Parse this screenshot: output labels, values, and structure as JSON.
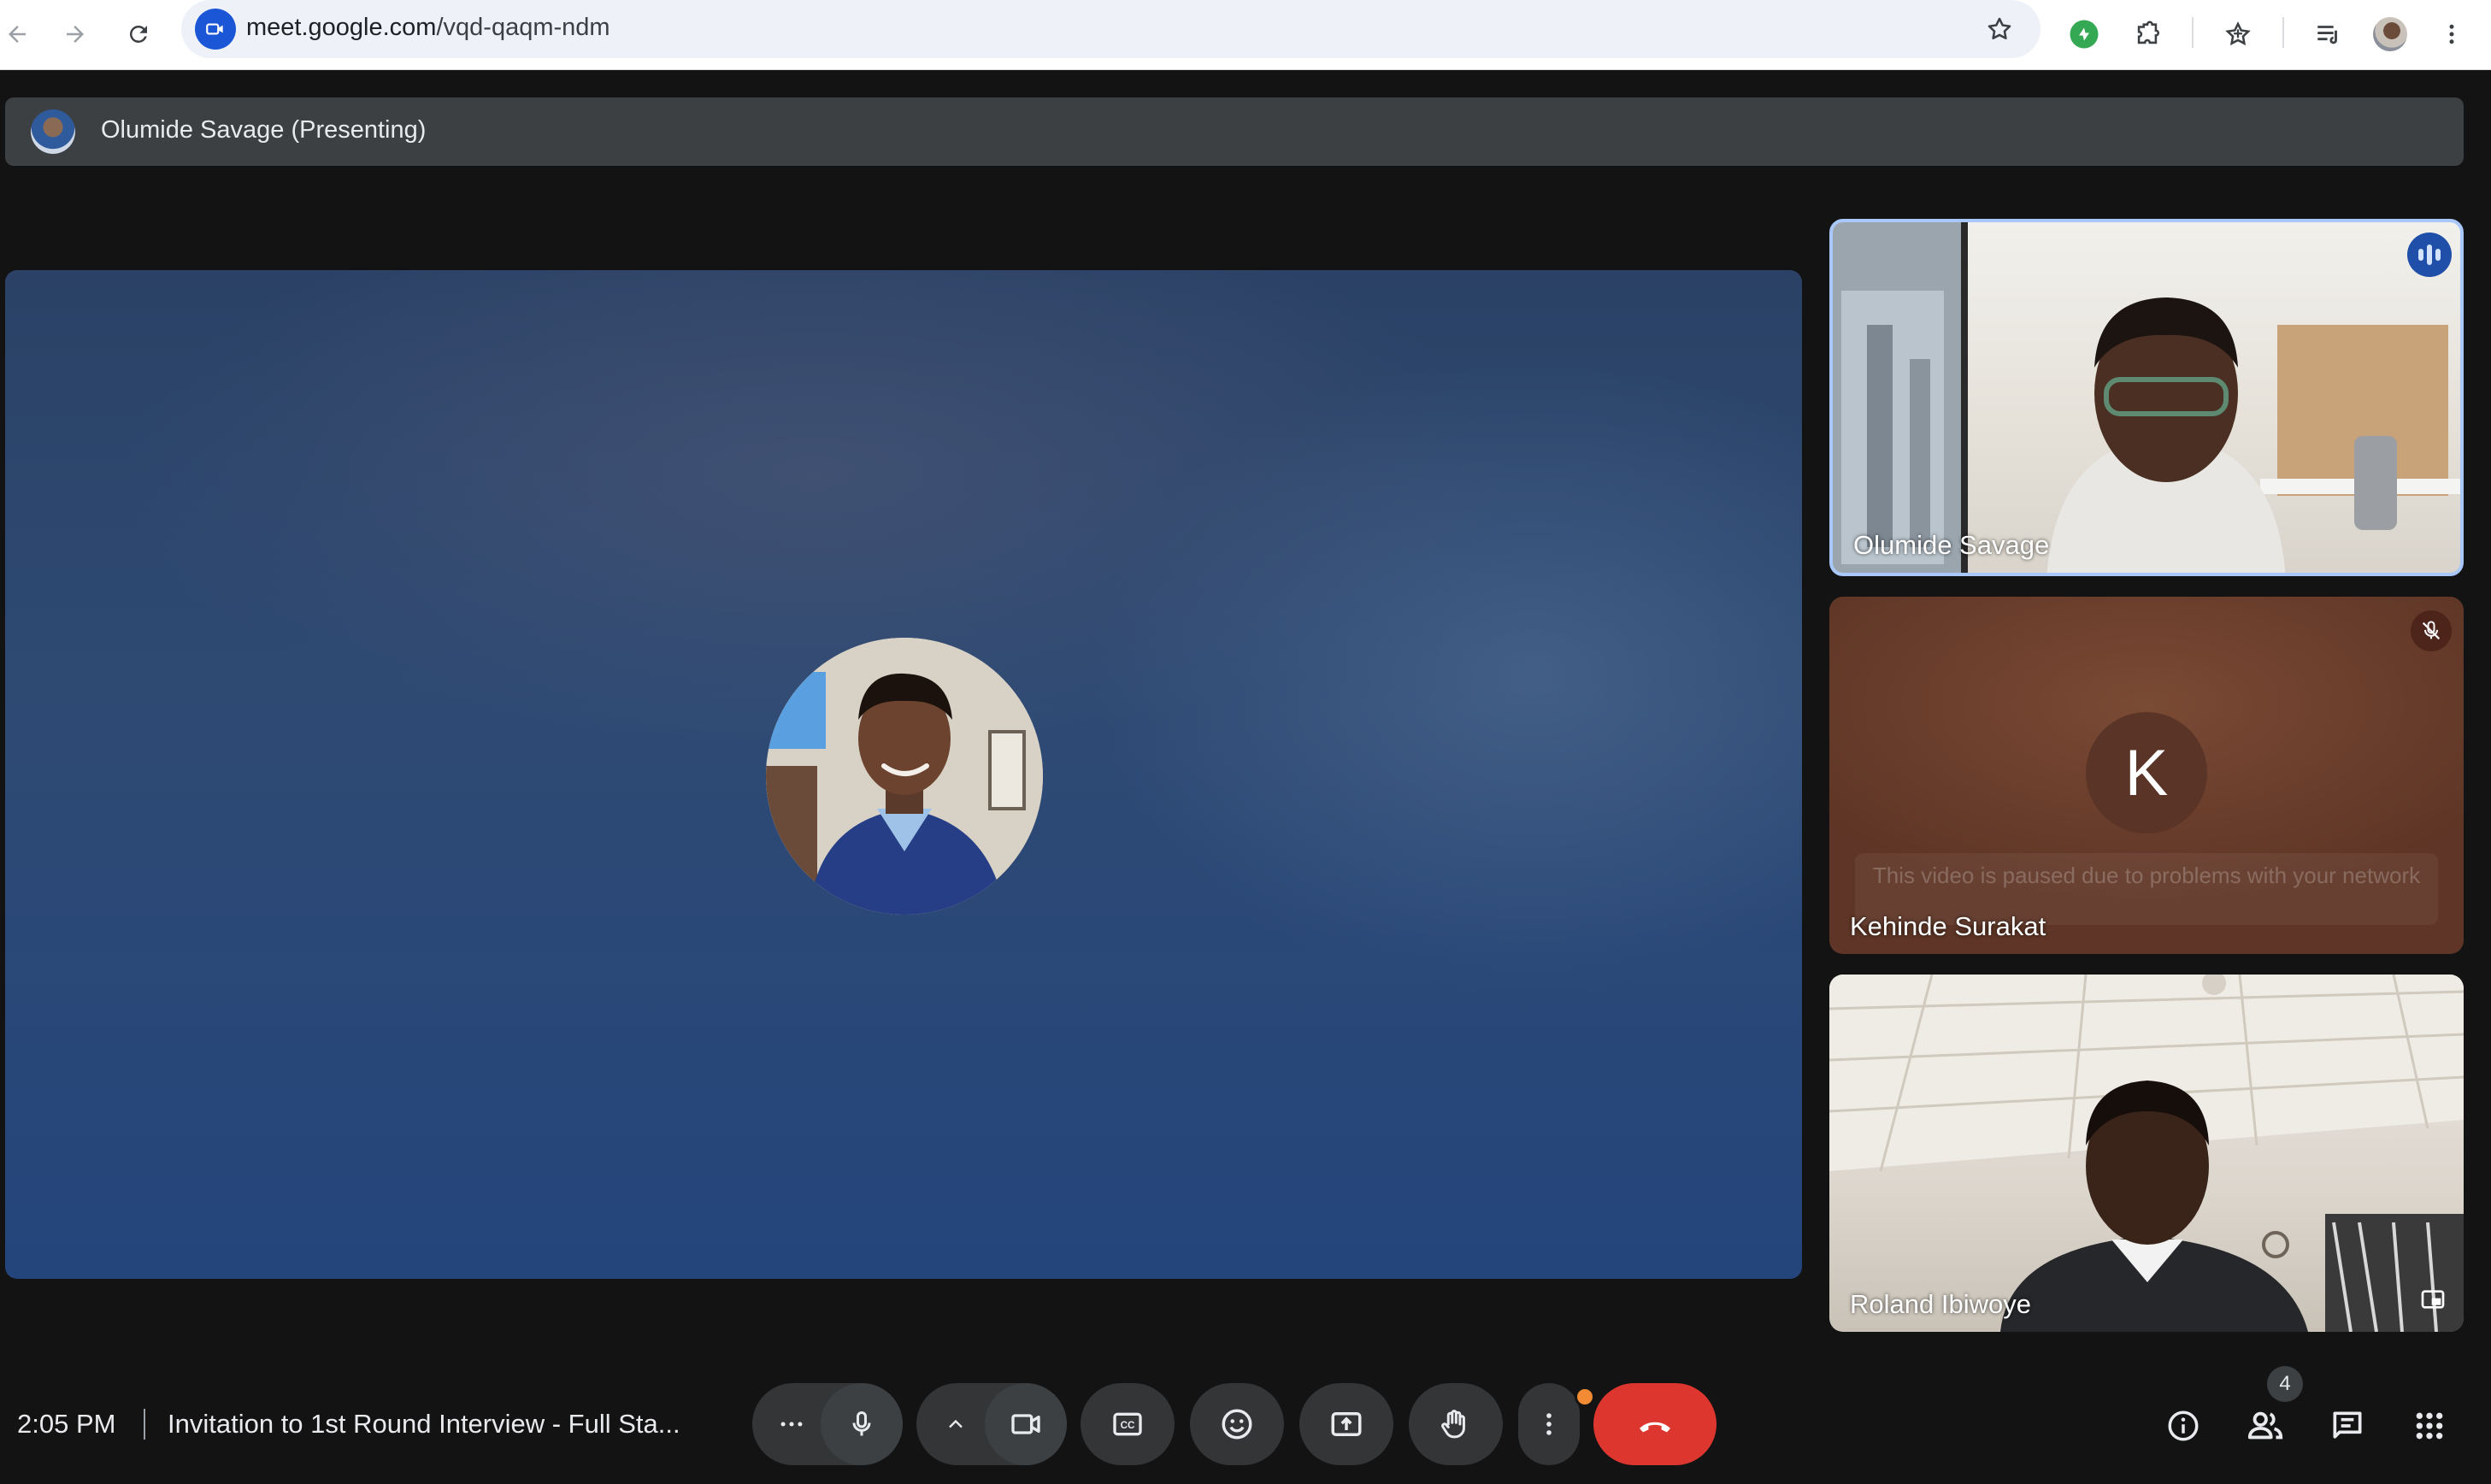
{
  "browser": {
    "url_host": "meet.google.com",
    "url_path": "/vqd-qaqm-ndm",
    "icons": [
      "back-arrow-icon",
      "forward-arrow-icon",
      "reload-icon",
      "meet-camera-icon",
      "bookmark-star-icon",
      "extension-green-icon",
      "puzzle-extensions-icon",
      "bookmarks-icon",
      "reading-list-icon",
      "profile-avatar",
      "chrome-menu-icon"
    ]
  },
  "presenting": {
    "label": "Olumide Savage (Presenting)"
  },
  "participants": [
    {
      "name": "Olumide Savage",
      "state": "speaking"
    },
    {
      "name": "Kehinde Surakat",
      "initial": "K",
      "state": "muted",
      "notice": "This video is paused due to problems with your network"
    },
    {
      "name": "Roland Ibiwoye",
      "state": "video"
    }
  ],
  "bottom_bar": {
    "time": "2:05 PM",
    "meeting_title": "Invitation to 1st Round Interview - Full Sta...",
    "people_count": "4"
  },
  "colors": {
    "end_call": "#dc362e",
    "speaking_border": "#a8c7fa",
    "notification_dot": "#f28b34",
    "background": "#131314"
  }
}
